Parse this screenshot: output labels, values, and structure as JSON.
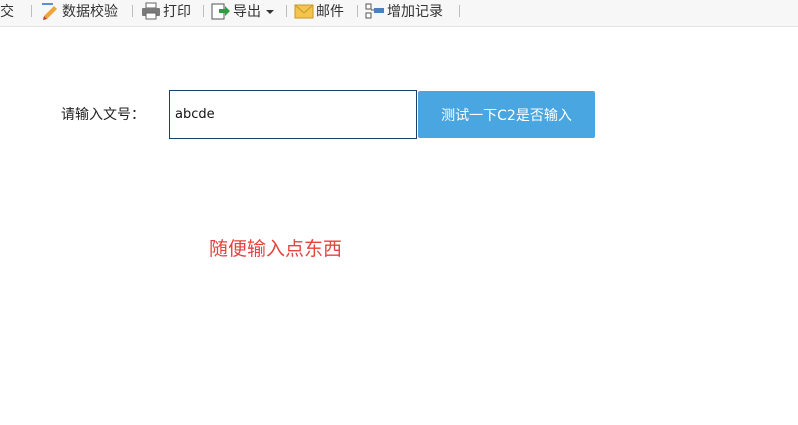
{
  "toolbar": {
    "items": [
      {
        "label": "提交",
        "icon": "submit-icon"
      },
      {
        "label": "数据校验",
        "icon": "pencil-icon"
      },
      {
        "label": "打印",
        "icon": "printer-icon"
      },
      {
        "label": "导出",
        "icon": "export-icon"
      },
      {
        "label": "邮件",
        "icon": "mail-icon"
      },
      {
        "label": "增加记录",
        "icon": "add-record-icon"
      }
    ]
  },
  "form": {
    "label": "请输入文号：",
    "input_value": "abcde",
    "button_label": "测试一下C2是否输入"
  },
  "hint_text": "随便输入点东西",
  "colors": {
    "button_bg": "#4aa6e0",
    "hint": "#e5443c",
    "input_border": "#1c3f6e"
  }
}
